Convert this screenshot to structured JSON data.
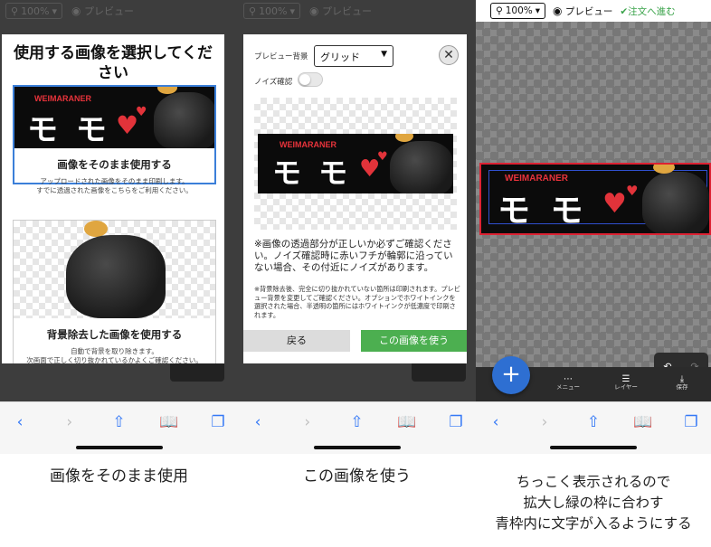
{
  "common": {
    "zoom": "100%",
    "preview": "プレビュー",
    "order_next": "注文へ進む",
    "banner": {
      "word": "WEIMARANER",
      "momo": "モ モ"
    }
  },
  "panel1": {
    "modal_title": "使用する画像を選択してください",
    "option1": {
      "title": "画像をそのまま使用する",
      "desc1": "アップロードされた画像をそのまま印刷します。",
      "desc2": "すでに透過された画像をこちらをご利用ください。"
    },
    "option2": {
      "title": "背景除去した画像を使用する",
      "desc1": "自動で背景を取り除きます。",
      "desc2": "次画面で正しく切り抜かれているかよくご確認ください。"
    },
    "caption": "画像をそのまま使用"
  },
  "panel2": {
    "bg_label": "プレビュー背景",
    "bg_value": "グリッド",
    "noise_label": "ノイズ確認",
    "notice": "※画像の透過部分が正しいか必ずご確認ください。ノイズ確認時に赤いフチが輪郭に沿っていない場合、その付近にノイズがあります。",
    "notice_small": "※背景除去後、完全に切り抜かれていない箇所は印刷されます。プレビュー背景を変更してご確認ください。オプションでホワイトインクを選択された場合、半透明の箇所にはホワイトインクが低濃度で印刷されます。",
    "back_label": "戻る",
    "use_label": "この画像を使う",
    "caption": "この画像を使う"
  },
  "panel3": {
    "menu_label": "メニュー",
    "layer_label": "レイヤー",
    "save_label": "保存",
    "caption_line1": "ちっこく表示されるので",
    "caption_line2": "拡大し緑の枠に合わす",
    "caption_line3": "青枠内に文字が入るようにする"
  },
  "colors": {
    "accent_green": "#4caf50",
    "accent_blue": "#2e6fd2",
    "select_border": "#3b7fd9",
    "banner_red": "#e8333b"
  }
}
